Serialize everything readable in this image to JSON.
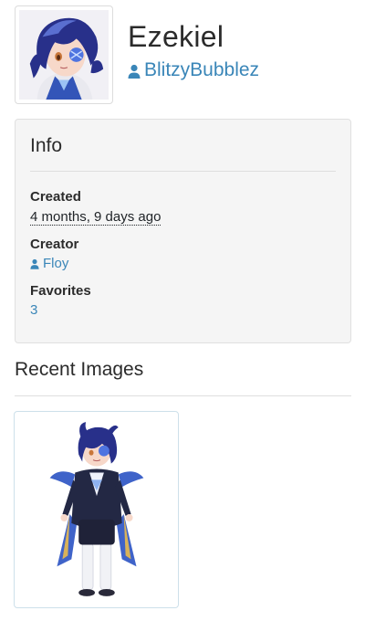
{
  "character": {
    "name": "Ezekiel",
    "owner": "BlitzyBubblez"
  },
  "info": {
    "title": "Info",
    "created_label": "Created",
    "created_value": "4 months, 9 days ago",
    "creator_label": "Creator",
    "creator_value": "Floy",
    "favorites_label": "Favorites",
    "favorites_value": "3"
  },
  "recent_images": {
    "title": "Recent Images"
  },
  "colors": {
    "link": "#3a86b8",
    "card_bg": "#f5f5f5",
    "text": "#2b2b2b"
  },
  "icons": {
    "owner": "person-icon",
    "creator": "person-icon"
  }
}
